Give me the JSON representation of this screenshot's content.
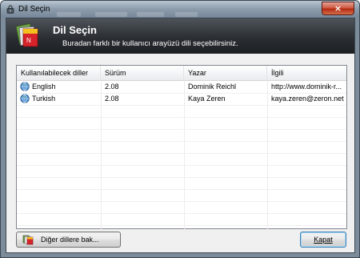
{
  "window": {
    "title": "Dil Seçin",
    "close_glyph": "×",
    "icon": "lock-icon"
  },
  "banner": {
    "title": "Dil Seçin",
    "subtitle": "Buradan farklı bir kullanıcı arayüzü dili seçebilirsiniz.",
    "icon": "languages-icon"
  },
  "list": {
    "columns": [
      "Kullanılabilecek diller",
      "Sürüm",
      "Yazar",
      "İlgili"
    ],
    "rows": [
      {
        "icon": "globe-icon",
        "language": "English",
        "version": "2.08",
        "author": "Dominik Reichl",
        "related": "http://www.dominik-r..."
      },
      {
        "icon": "globe-icon",
        "language": "Turkish",
        "version": "2.08",
        "author": "Kaya Zeren",
        "related": "kaya.zeren@zeron.net"
      }
    ]
  },
  "buttons": {
    "more_label": "Diğer dillere bak...",
    "close_label": "Kapat"
  },
  "colors": {
    "banner": "#2b2f34",
    "close_button": "#c0432a"
  }
}
